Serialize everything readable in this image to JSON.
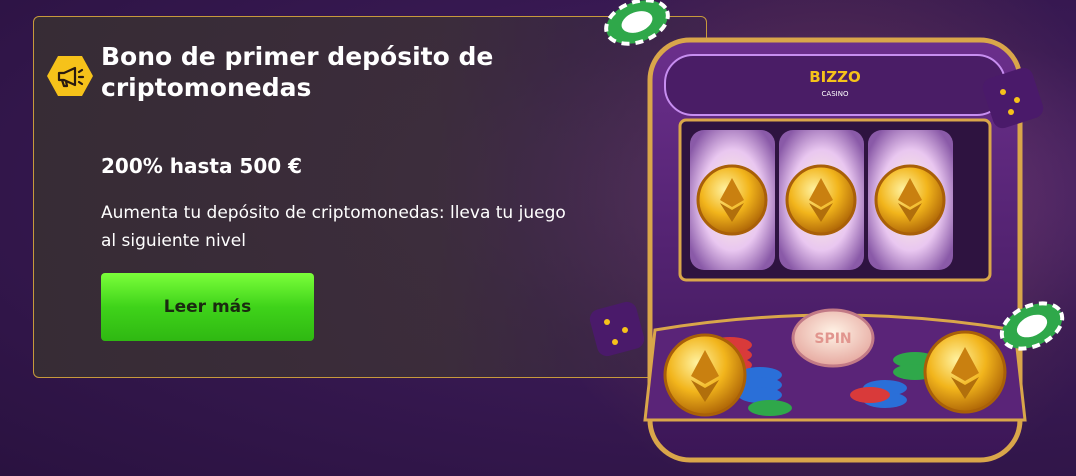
{
  "promo": {
    "title": "Bono de primer depósito de criptomonedas",
    "amount": "200% hasta 500 €",
    "description": "Aumenta tu depósito de criptomonedas: lleva tu juego al siguiente nivel",
    "cta_label": "Leer más",
    "badge_icon": "megaphone-icon"
  },
  "slot_machine": {
    "brand": "BIZZO",
    "brand_sub": "CASINO",
    "spin_label": "SPIN",
    "reel_symbol": "ethereum-coin-icon"
  },
  "colors": {
    "accent_yellow": "#f6c21a",
    "cta_green": "#3fd31a",
    "card_border": "#c79a3c",
    "background_purple": "#3a1a55"
  }
}
